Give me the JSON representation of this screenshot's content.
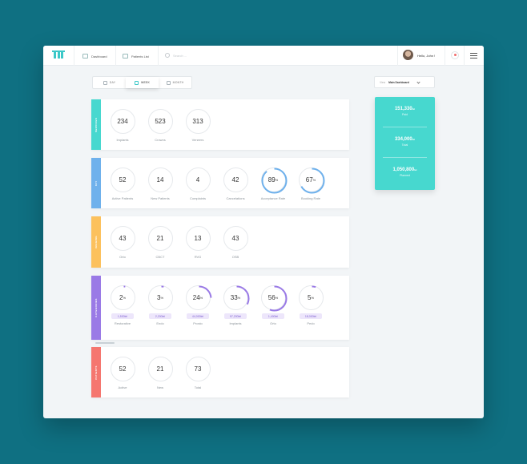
{
  "nav": {
    "dashboard": "Dashboard",
    "patients": "Patients List",
    "search_placeholder": "Search ...",
    "greeting": "Hello, John !"
  },
  "periods": [
    "DAY",
    "WEEK",
    "MONTH"
  ],
  "view": {
    "label": "View",
    "value": "Main Dashboard"
  },
  "summary": [
    {
      "value": "151,330",
      "unit": "lei",
      "label": "Paid"
    },
    {
      "value": "334,000",
      "unit": "lei",
      "label": "Total"
    },
    {
      "value": "1,050,800",
      "unit": "lei",
      "label": "Planned"
    }
  ],
  "sections": {
    "services": {
      "tab": "SERVICES",
      "color": "#47d8cf",
      "items": [
        {
          "value": "234",
          "label": "Implants"
        },
        {
          "value": "523",
          "label": "Crowns"
        },
        {
          "value": "313",
          "label": "Veneers"
        }
      ]
    },
    "kpi": {
      "tab": "KPI",
      "color": "#6fb1ec",
      "items": [
        {
          "value": "52",
          "label": "Active Patients"
        },
        {
          "value": "14",
          "label": "New Patients"
        },
        {
          "value": "4",
          "label": "Complaints"
        },
        {
          "value": "42",
          "label": "Cancelations"
        },
        {
          "value": "89",
          "label": "Acceptance Rate",
          "ring": 0.89
        },
        {
          "value": "67",
          "label": "Booking Rate",
          "ring": 0.67
        }
      ]
    },
    "imaging": {
      "tab": "IMAGING",
      "color": "#fcc15d",
      "items": [
        {
          "value": "43",
          "label": "Orto"
        },
        {
          "value": "21",
          "label": "CBCT"
        },
        {
          "value": "13",
          "label": "RVG"
        },
        {
          "value": "43",
          "label": "OSB"
        }
      ]
    },
    "categories": {
      "tab": "CATEGORIES",
      "color": "#9a7ae6",
      "items": [
        {
          "value": "2",
          "chip": "1,530lei",
          "label": "Restorative",
          "ring": 0.02
        },
        {
          "value": "3",
          "chip": "2,200lei",
          "label": "Endo",
          "ring": 0.03
        },
        {
          "value": "24",
          "chip": "44,000lei",
          "label": "Prosto",
          "ring": 0.24
        },
        {
          "value": "33",
          "chip": "97,200lei",
          "label": "Implants",
          "ring": 0.33
        },
        {
          "value": "56",
          "chip": "1,400lei",
          "label": "Orto",
          "ring": 0.56
        },
        {
          "value": "5",
          "chip": "18,000lei",
          "label": "Pedo",
          "ring": 0.05
        }
      ]
    },
    "patients": {
      "tab": "PATIENTS",
      "color": "#f5766f",
      "items": [
        {
          "value": "52",
          "label": "Active"
        },
        {
          "value": "21",
          "label": "New"
        },
        {
          "value": "73",
          "label": "Total"
        }
      ]
    }
  }
}
